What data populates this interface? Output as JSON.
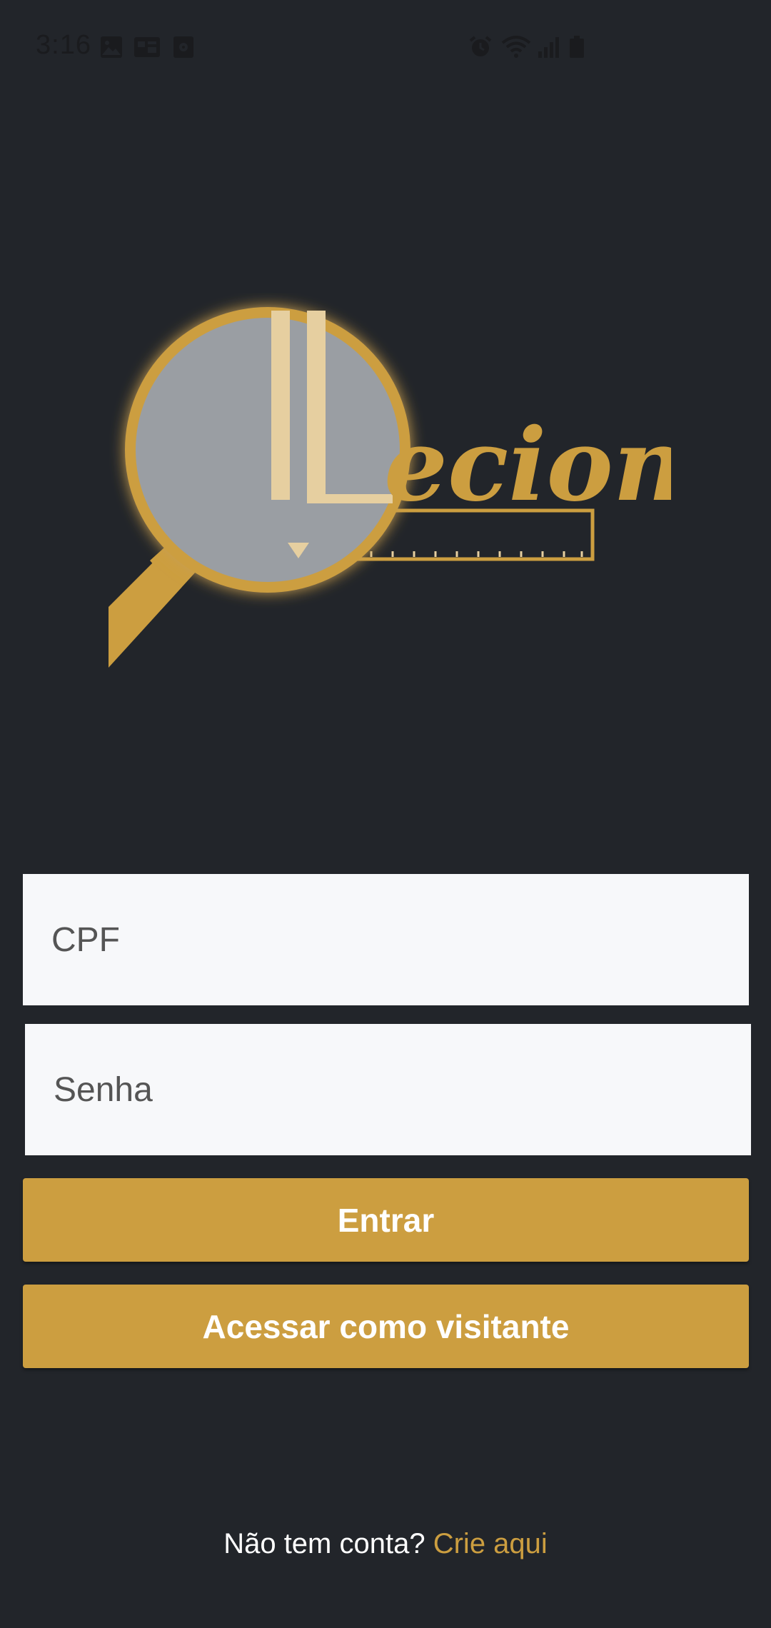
{
  "status_bar": {
    "time": "3:16",
    "left_icons": [
      "image-icon",
      "sim-card-icon",
      "storage-icon"
    ],
    "right_icons": [
      "alarm-icon",
      "wifi-icon",
      "signal-icon",
      "battery-icon"
    ]
  },
  "logo": {
    "text": "ecione",
    "colors": {
      "gold": "#cc9e40",
      "lens": "#9a9ea3",
      "cream": "#e6cfa0"
    }
  },
  "form": {
    "cpf_placeholder": "CPF",
    "senha_placeholder": "Senha"
  },
  "buttons": {
    "entrar": "Entrar",
    "visitante": "Acessar como visitante"
  },
  "footer": {
    "prompt": "Não tem conta?",
    "link": "Crie aqui"
  },
  "colors": {
    "background": "#22252a",
    "accent": "#cc9e40",
    "input_bg": "#f7f8fa",
    "text_light": "#ffffff"
  }
}
